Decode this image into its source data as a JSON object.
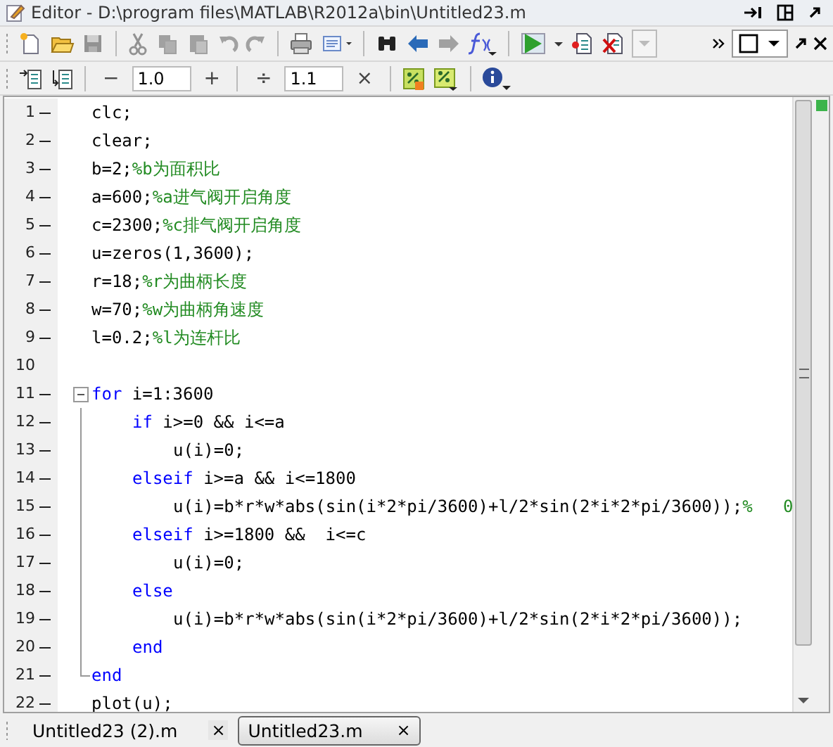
{
  "window": {
    "title": "Editor - D:\\program files\\MATLAB\\R2012a\\bin\\Untitled23.m"
  },
  "cell_toolbar": {
    "decrement": "−",
    "step_value": "1.0",
    "increment": "+",
    "divide": "÷",
    "factor_value": "1.1",
    "multiply": "×"
  },
  "editor": {
    "lines": [
      {
        "number": "1",
        "executable": true,
        "segments": [
          {
            "kind": "code",
            "text": "clc;"
          }
        ]
      },
      {
        "number": "2",
        "executable": true,
        "segments": [
          {
            "kind": "code",
            "text": "clear;"
          }
        ]
      },
      {
        "number": "3",
        "executable": true,
        "segments": [
          {
            "kind": "code",
            "text": "b=2;"
          },
          {
            "kind": "comment",
            "text": "%b为面积比"
          }
        ]
      },
      {
        "number": "4",
        "executable": true,
        "segments": [
          {
            "kind": "code",
            "text": "a=600;"
          },
          {
            "kind": "comment",
            "text": "%a进气阀开启角度"
          }
        ]
      },
      {
        "number": "5",
        "executable": true,
        "segments": [
          {
            "kind": "code",
            "text": "c=2300;"
          },
          {
            "kind": "comment",
            "text": "%c排气阀开启角度"
          }
        ]
      },
      {
        "number": "6",
        "executable": true,
        "segments": [
          {
            "kind": "code",
            "text": "u=zeros(1,3600);"
          }
        ]
      },
      {
        "number": "7",
        "executable": true,
        "segments": [
          {
            "kind": "code",
            "text": "r=18;"
          },
          {
            "kind": "comment",
            "text": "%r为曲柄长度"
          }
        ]
      },
      {
        "number": "8",
        "executable": true,
        "segments": [
          {
            "kind": "code",
            "text": "w=70;"
          },
          {
            "kind": "comment",
            "text": "%w为曲柄角速度"
          }
        ]
      },
      {
        "number": "9",
        "executable": true,
        "segments": [
          {
            "kind": "code",
            "text": "l=0.2;"
          },
          {
            "kind": "comment",
            "text": "%l为连杆比"
          }
        ]
      },
      {
        "number": "10",
        "executable": false
      },
      {
        "number": "11",
        "executable": true,
        "expanded": true,
        "segments": [
          {
            "kind": "keyword",
            "text": "for"
          },
          {
            "kind": "code",
            "text": " i=1:3600"
          }
        ],
        "children": [
          {
            "number": "12",
            "executable": true,
            "segments": [
              {
                "kind": "keyword",
                "text": "if"
              },
              {
                "kind": "code",
                "text": " i>=0 && i<=a"
              }
            ],
            "children": [
              {
                "number": "13",
                "executable": true,
                "segments": [
                  {
                    "kind": "code",
                    "text": "u(i)=0;"
                  }
                ]
              }
            ]
          },
          {
            "number": "14",
            "executable": true,
            "segments": [
              {
                "kind": "keyword",
                "text": "elseif"
              },
              {
                "kind": "code",
                "text": " i>=a && i<=1800"
              }
            ],
            "children": [
              {
                "number": "15",
                "executable": true,
                "segments": [
                  {
                    "kind": "code",
                    "text": "u(i)=b*r*w*abs(sin(i*2*pi/3600)+l/2*sin(2*i*2*pi/3600));"
                  },
                  {
                    "kind": "comment",
                    "text": "%   0"
                  }
                ]
              }
            ]
          },
          {
            "number": "16",
            "executable": true,
            "segments": [
              {
                "kind": "keyword",
                "text": "elseif"
              },
              {
                "kind": "code",
                "text": " i>=1800 &&  i<=c"
              }
            ],
            "children": [
              {
                "number": "17",
                "executable": true,
                "segments": [
                  {
                    "kind": "code",
                    "text": "u(i)=0;"
                  }
                ]
              }
            ]
          },
          {
            "number": "18",
            "executable": true,
            "segments": [
              {
                "kind": "keyword",
                "text": "else"
              }
            ],
            "children": [
              {
                "number": "19",
                "executable": true,
                "segments": [
                  {
                    "kind": "code",
                    "text": "u(i)=b*r*w*abs(sin(i*2*pi/3600)+l/2*sin(2*i*2*pi/3600));"
                  }
                ]
              }
            ]
          },
          {
            "number": "20",
            "executable": true,
            "segments": [
              {
                "kind": "keyword",
                "text": "end"
              }
            ]
          },
          {
            "number": "21",
            "executable": true,
            "kind": "block_end",
            "segments": [
              {
                "kind": "keyword",
                "text": "end"
              }
            ]
          }
        ]
      },
      {
        "number": "22",
        "executable": true,
        "segments": [
          {
            "kind": "code",
            "text": "plot(u);"
          }
        ]
      }
    ]
  },
  "tabs": [
    {
      "label": "Untitled23 (2).m",
      "selected": false,
      "close": "×"
    },
    {
      "label": "Untitled23.m",
      "selected": true,
      "close": "×"
    }
  ]
}
